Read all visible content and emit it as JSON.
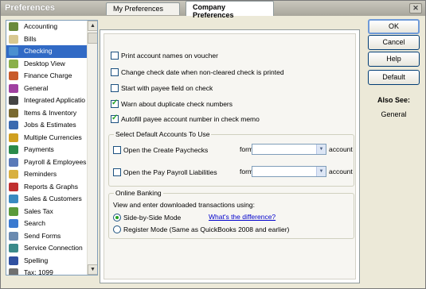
{
  "window": {
    "title": "Preferences",
    "close_label": "✕"
  },
  "sidebar": {
    "items": [
      {
        "label": "Accounting",
        "icon": "accounting-icon",
        "color": "#6a8a3a"
      },
      {
        "label": "Bills",
        "icon": "bills-icon",
        "color": "#d8c890"
      },
      {
        "label": "Checking",
        "icon": "checking-icon",
        "color": "#4a8fd0",
        "selected": true
      },
      {
        "label": "Desktop View",
        "icon": "desktop-view-icon",
        "color": "#8ab04a"
      },
      {
        "label": "Finance Charge",
        "icon": "finance-charge-icon",
        "color": "#c85a2a"
      },
      {
        "label": "General",
        "icon": "general-icon",
        "color": "#a040a0"
      },
      {
        "label": "Integrated Applicatio",
        "icon": "integrated-apps-icon",
        "color": "#444444"
      },
      {
        "label": "Items & Inventory",
        "icon": "items-inventory-icon",
        "color": "#7a6a30"
      },
      {
        "label": "Jobs & Estimates",
        "icon": "jobs-estimates-icon",
        "color": "#3a6ab0"
      },
      {
        "label": "Multiple Currencies",
        "icon": "multiple-currencies-icon",
        "color": "#d0a020"
      },
      {
        "label": "Payments",
        "icon": "payments-icon",
        "color": "#2a8a4a"
      },
      {
        "label": "Payroll & Employees",
        "icon": "payroll-icon",
        "color": "#5a7ab8"
      },
      {
        "label": "Reminders",
        "icon": "reminders-icon",
        "color": "#d8b040"
      },
      {
        "label": "Reports & Graphs",
        "icon": "reports-graphs-icon",
        "color": "#c03030"
      },
      {
        "label": "Sales & Customers",
        "icon": "sales-customers-icon",
        "color": "#3a8ac0"
      },
      {
        "label": "Sales Tax",
        "icon": "sales-tax-icon",
        "color": "#5a9a3a"
      },
      {
        "label": "Search",
        "icon": "search-icon",
        "color": "#3a7ad0"
      },
      {
        "label": "Send Forms",
        "icon": "send-forms-icon",
        "color": "#6a8ab0"
      },
      {
        "label": "Service Connection",
        "icon": "service-connection-icon",
        "color": "#3a8a8a"
      },
      {
        "label": "Spelling",
        "icon": "spelling-icon",
        "color": "#3050a0"
      },
      {
        "label": "Tax: 1099",
        "icon": "tax-1099-icon",
        "color": "#707070"
      }
    ]
  },
  "tabs": [
    {
      "label": "My Preferences",
      "active": false
    },
    {
      "label": "Company Preferences",
      "active": true
    }
  ],
  "options": [
    {
      "label": "Print account names on voucher",
      "checked": false
    },
    {
      "label": "Change check date when non-cleared check is printed",
      "checked": false
    },
    {
      "label": "Start with payee field on check",
      "checked": false
    },
    {
      "label": "Warn about duplicate check numbers",
      "checked": true
    },
    {
      "label": "Autofill payee account number in check memo",
      "checked": true
    }
  ],
  "default_accounts": {
    "title": "Select Default Accounts To Use",
    "rows": [
      {
        "label": "Open the Create Paychecks",
        "form_with": "form with",
        "account": "account",
        "value": ""
      },
      {
        "label": "Open the Pay Payroll Liabilities",
        "form_with": "form with",
        "account": "account",
        "value": ""
      }
    ]
  },
  "online_banking": {
    "title": "Online Banking",
    "description": "View and enter downloaded transactions using:",
    "modes": [
      {
        "label": "Side-by-Side Mode",
        "selected": true
      },
      {
        "label": "Register Mode (Same as QuickBooks 2008 and earlier)",
        "selected": false
      }
    ],
    "link": "What's the difference?"
  },
  "buttons": {
    "ok": "OK",
    "cancel": "Cancel",
    "help": "Help",
    "default": "Default"
  },
  "also_see": {
    "heading": "Also See:",
    "items": [
      "General"
    ]
  }
}
